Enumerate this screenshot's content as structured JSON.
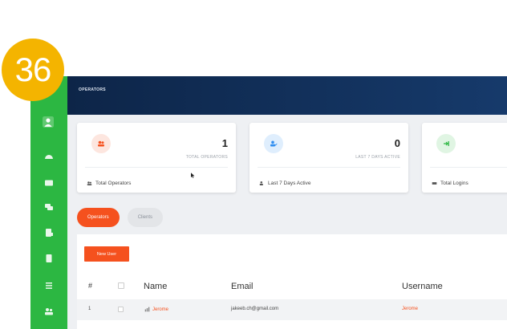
{
  "step_badge": "36",
  "header": {
    "title": "OPERATORS"
  },
  "cards": [
    {
      "value": "1",
      "label": "TOTAL OPERATORS",
      "footer": "Total Operators",
      "icon": "users-icon",
      "accent": "#f5511e",
      "tint": "#fde6df"
    },
    {
      "value": "0",
      "label": "LAST 7 DAYS ACTIVE",
      "footer": "Last 7 Days Active",
      "icon": "user-check-icon",
      "accent": "#2f8df0",
      "tint": "#dfeefd"
    },
    {
      "value": "",
      "label": "",
      "footer": "Total Logins",
      "icon": "login-icon",
      "accent": "#2cb742",
      "tint": "#e0f5e3"
    }
  ],
  "tabs": [
    {
      "label": "Operators",
      "active": true
    },
    {
      "label": "Clients",
      "active": false
    }
  ],
  "new_user_button": "New User",
  "table": {
    "headers": {
      "num": "#",
      "name": "Name",
      "email": "Email",
      "username": "Username"
    },
    "rows": [
      {
        "num": "1",
        "name": "Jerome",
        "email": "jakeeb.ch@gmail.com",
        "username": "Jerome"
      }
    ]
  },
  "sidebar_icons": [
    "user-avatar-icon",
    "dashboard-icon",
    "id-card-icon",
    "chat-icon",
    "reports-icon",
    "document-icon",
    "list-icon",
    "users-icon"
  ],
  "colors": {
    "sidebar": "#2cb742",
    "header": "#0d2548",
    "accent": "#f5511e",
    "badge": "#f4b400"
  }
}
